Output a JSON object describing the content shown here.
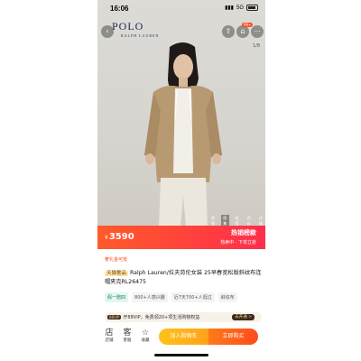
{
  "status": {
    "time": "16:06",
    "network": "5G"
  },
  "header": {
    "brand": "POLO",
    "brand_sub": "RALPH LAUREN",
    "cart_count": "99+",
    "pager": "1/8"
  },
  "media_tabs": [
    "视频",
    "图集",
    "穿搭",
    "评价",
    "详情"
  ],
  "price_bar": {
    "currency": "¥",
    "price": "3590",
    "hot_label": "热销榜款",
    "hot_sub": "热卖中 · 下单立抢"
  },
  "gift_text": "奢礼金可抵",
  "product": {
    "tag": "天猫奢品",
    "title": "Ralph Lauren/拉夫劳伦女装 25早春宽松版斜纹布连帽夹克RL26475"
  },
  "chips": [
    "假一赔四",
    "800+人感兴趣",
    "近7天700+人逛过",
    "斜纹布"
  ],
  "vip": {
    "badge": "88VIP",
    "text": "开88VIP，免费领20+项生活购物权益",
    "action": "去开通 >"
  },
  "bottom_nav": [
    {
      "icon": "店",
      "label": "店铺"
    },
    {
      "icon": "客",
      "label": "客服"
    },
    {
      "icon": "☆",
      "label": "收藏"
    }
  ],
  "buttons": {
    "add_cart": "加入购物车",
    "buy_now": "立即购买"
  }
}
